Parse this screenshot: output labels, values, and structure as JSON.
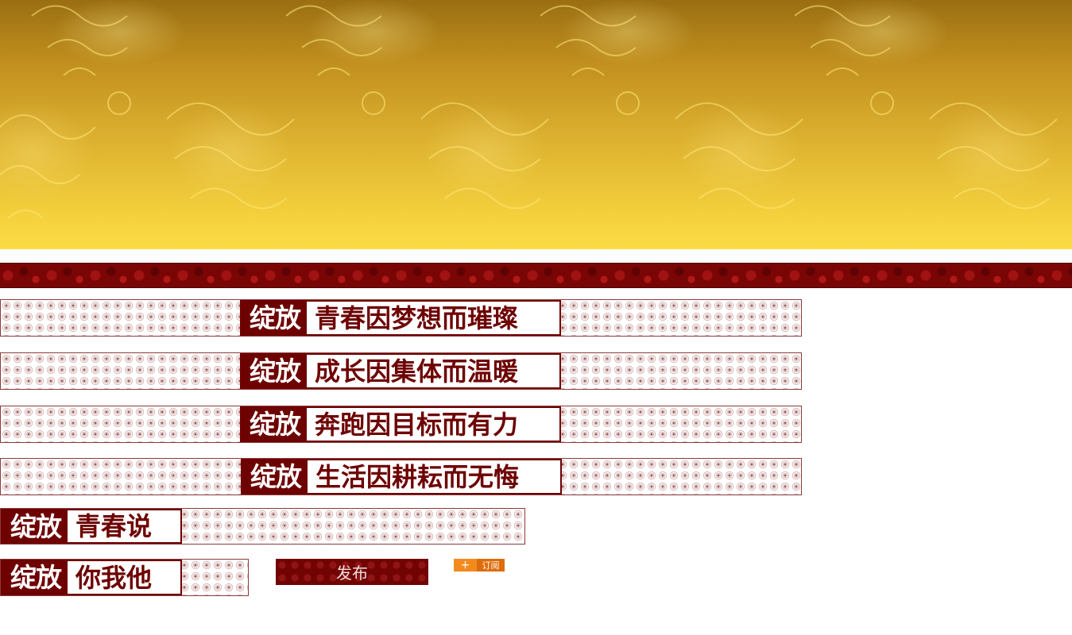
{
  "banner": {
    "colors": {
      "gold_dark": "#9a6e12",
      "gold_light": "#fbdc45",
      "red_band": "#7a0505"
    }
  },
  "sections": [
    {
      "lead": "绽放",
      "title": "青春因梦想而璀璨"
    },
    {
      "lead": "绽放",
      "title": "成长因集体而温暖"
    },
    {
      "lead": "绽放",
      "title": "奔跑因目标而有力"
    },
    {
      "lead": "绽放",
      "title": "生活因耕耘而无悔"
    }
  ],
  "short_sections": [
    {
      "lead": "绽放",
      "title": "青春说"
    },
    {
      "lead": "绽放",
      "title": "你我他"
    }
  ],
  "actions": {
    "publish_label": "发布",
    "subscribe_plus": "+",
    "subscribe_label": "订阅"
  },
  "colors": {
    "maroon": "#6e0101",
    "orange": "#f38a1e",
    "orange_dark": "#dd6d0b"
  }
}
